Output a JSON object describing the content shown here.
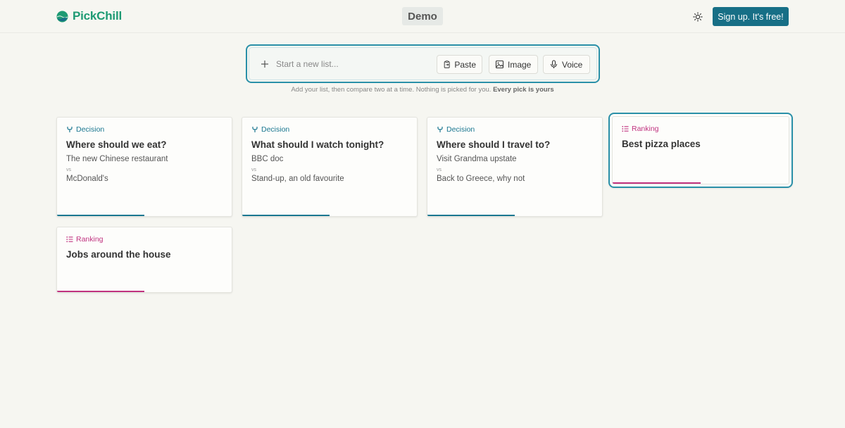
{
  "header": {
    "logo_text": "PickChill",
    "logo_icon": "pickchill-logo-icon",
    "demo_label": "Demo",
    "theme_icon": "sun-icon",
    "signup_label": "Sign up. It's free!"
  },
  "newlist": {
    "plus_icon": "plus-icon",
    "placeholder": "Start a new list...",
    "paste_label": "Paste",
    "image_label": "Image",
    "voice_label": "Voice",
    "helper_text": "Add your list, then compare two at a time. Nothing is picked for you.",
    "helper_bold": "Every pick is yours"
  },
  "colors": {
    "brand": "#1d9a73",
    "accent": "#176f86",
    "decision": "#1a7790",
    "ranking": "#c0327f"
  },
  "cards": [
    {
      "type": "Decision",
      "title": "Where should we eat?",
      "option_a": "The new Chinese restaurant",
      "vs": "vs",
      "option_b": "McDonald's",
      "progress": 0.5
    },
    {
      "type": "Decision",
      "title": "What should I watch tonight?",
      "option_a": "BBC doc",
      "vs": "vs",
      "option_b": "Stand-up, an old favourite",
      "progress": 0.5
    },
    {
      "type": "Decision",
      "title": "Where should I travel to?",
      "option_a": "Visit Grandma upstate",
      "vs": "vs",
      "option_b": "Back to Greece, why not",
      "progress": 0.5
    },
    {
      "type": "Ranking",
      "title": "Best pizza places",
      "progress": 0.5
    },
    {
      "type": "Ranking",
      "title": "Jobs around the house",
      "progress": 0.5
    }
  ]
}
